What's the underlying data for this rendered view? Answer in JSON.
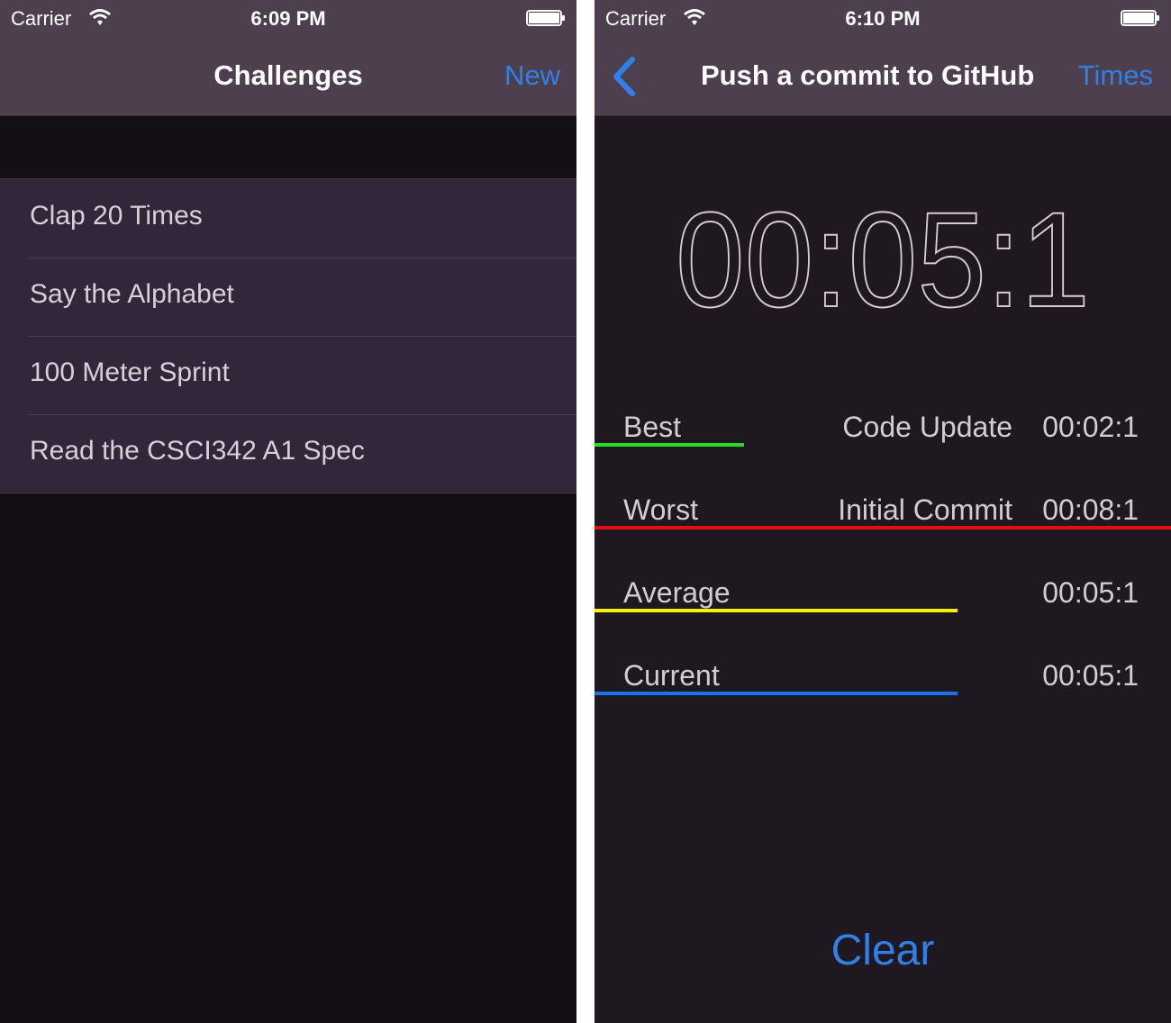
{
  "colors": {
    "accent": "#2f80e8",
    "navbar": "#4e3f4e",
    "left_bg": "#130f15",
    "right_bg": "#201820",
    "cell_bg": "#33263a",
    "best": "#22dd22",
    "worst": "#e01010",
    "average": "#f2f210",
    "current": "#1a73e8"
  },
  "left_screen": {
    "status": {
      "carrier": "Carrier",
      "time": "6:09 PM",
      "icons": [
        "wifi-icon",
        "battery-icon"
      ]
    },
    "nav": {
      "title": "Challenges",
      "new_label": "New"
    },
    "challenges": [
      "Clap 20 Times",
      "Say the Alphabet",
      "100 Meter Sprint",
      "Read the CSCI342 A1 Spec"
    ]
  },
  "right_screen": {
    "status": {
      "carrier": "Carrier",
      "time": "6:10 PM",
      "icons": [
        "wifi-icon",
        "battery-icon"
      ]
    },
    "nav": {
      "back_icon": "chevron-left-icon",
      "title": "Push a commit to GitHub",
      "times_label": "Times"
    },
    "timer": "00:05:1",
    "stats": [
      {
        "label": "Best",
        "name": "Code Update",
        "time": "00:02:1",
        "color": "#22dd22",
        "bar_fraction": 0.26
      },
      {
        "label": "Worst",
        "name": "Initial Commit",
        "time": "00:08:1",
        "color": "#e01010",
        "bar_fraction": 1.0
      },
      {
        "label": "Average",
        "name": "",
        "time": "00:05:1",
        "color": "#f2f210",
        "bar_fraction": 0.63
      },
      {
        "label": "Current",
        "name": "",
        "time": "00:05:1",
        "color": "#1a73e8",
        "bar_fraction": 0.63
      }
    ],
    "clear_label": "Clear"
  }
}
